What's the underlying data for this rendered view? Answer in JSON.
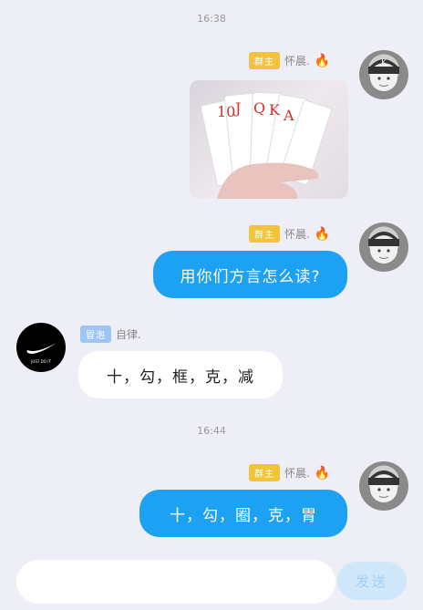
{
  "chat": {
    "timestamps": [
      "16:38",
      "16:44"
    ],
    "owner": {
      "badge": "群主",
      "nickname": "怀晨."
    },
    "other_user": {
      "badge": "冒泡",
      "nickname": "自律."
    },
    "messages": {
      "m1_image_alt": "",
      "m2": "用你们方言怎么读?",
      "m3": "十，勾，框，克，减",
      "m4": "十，勾，圈，克，胃"
    },
    "cards": [
      "10",
      "J",
      "Q",
      "K",
      "A"
    ],
    "nike_avatar_text": "JUST DO IT"
  },
  "input": {
    "placeholder": "",
    "send_label": "发送"
  },
  "colors": {
    "bubble_me": "#1da1f2",
    "owner_badge": "#f3c43a",
    "member_badge": "#9fc6f2",
    "bg": "#eeeef6"
  }
}
